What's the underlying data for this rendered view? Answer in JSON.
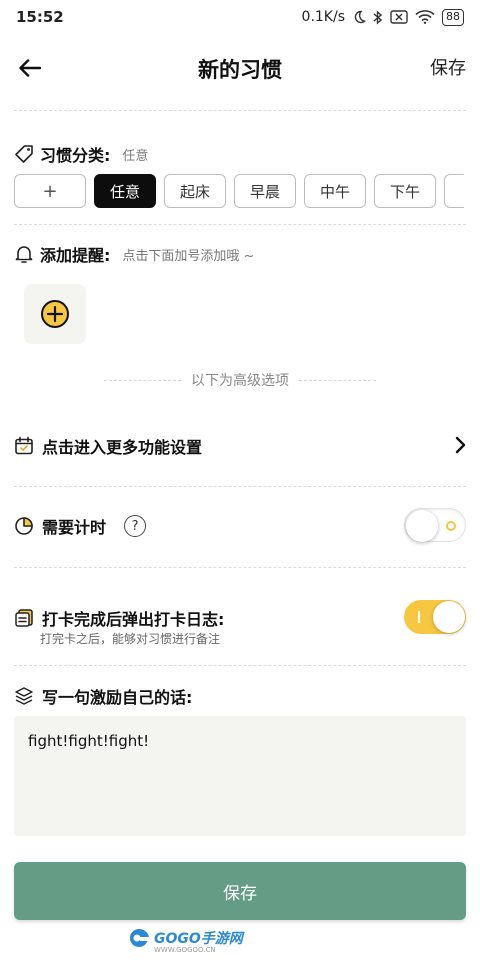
{
  "status_bar": {
    "time": "15:52",
    "net_speed": "0.1K/s",
    "battery": "88"
  },
  "header": {
    "title": "新的习惯",
    "save_label": "保存"
  },
  "category": {
    "label": "习惯分类:",
    "selected": "任意",
    "add_label": "+",
    "chips": [
      "任意",
      "起床",
      "早晨",
      "中午",
      "下午"
    ]
  },
  "reminder": {
    "label": "添加提醒:",
    "hint": "点击下面加号添加哦 ~"
  },
  "advanced_divider": "以下为高级选项",
  "more_settings": {
    "label": "点击进入更多功能设置"
  },
  "timer": {
    "label": "需要计时",
    "help": "?",
    "enabled": false
  },
  "checkin_log": {
    "label": "打卡完成后弹出打卡日志:",
    "sub": "打完卡之后，能够对习惯进行备注",
    "enabled": true
  },
  "motto": {
    "label": "写一句激励自己的话:",
    "value": "fight!fight!fight!"
  },
  "save_button": "保存",
  "watermark": {
    "text": "GOGO手游网",
    "sub": "WWW.GOGOO.CN"
  },
  "colors": {
    "accent_green": "#649c85",
    "toggle_on": "#f7c742",
    "active_chip": "#0d0d0d"
  }
}
